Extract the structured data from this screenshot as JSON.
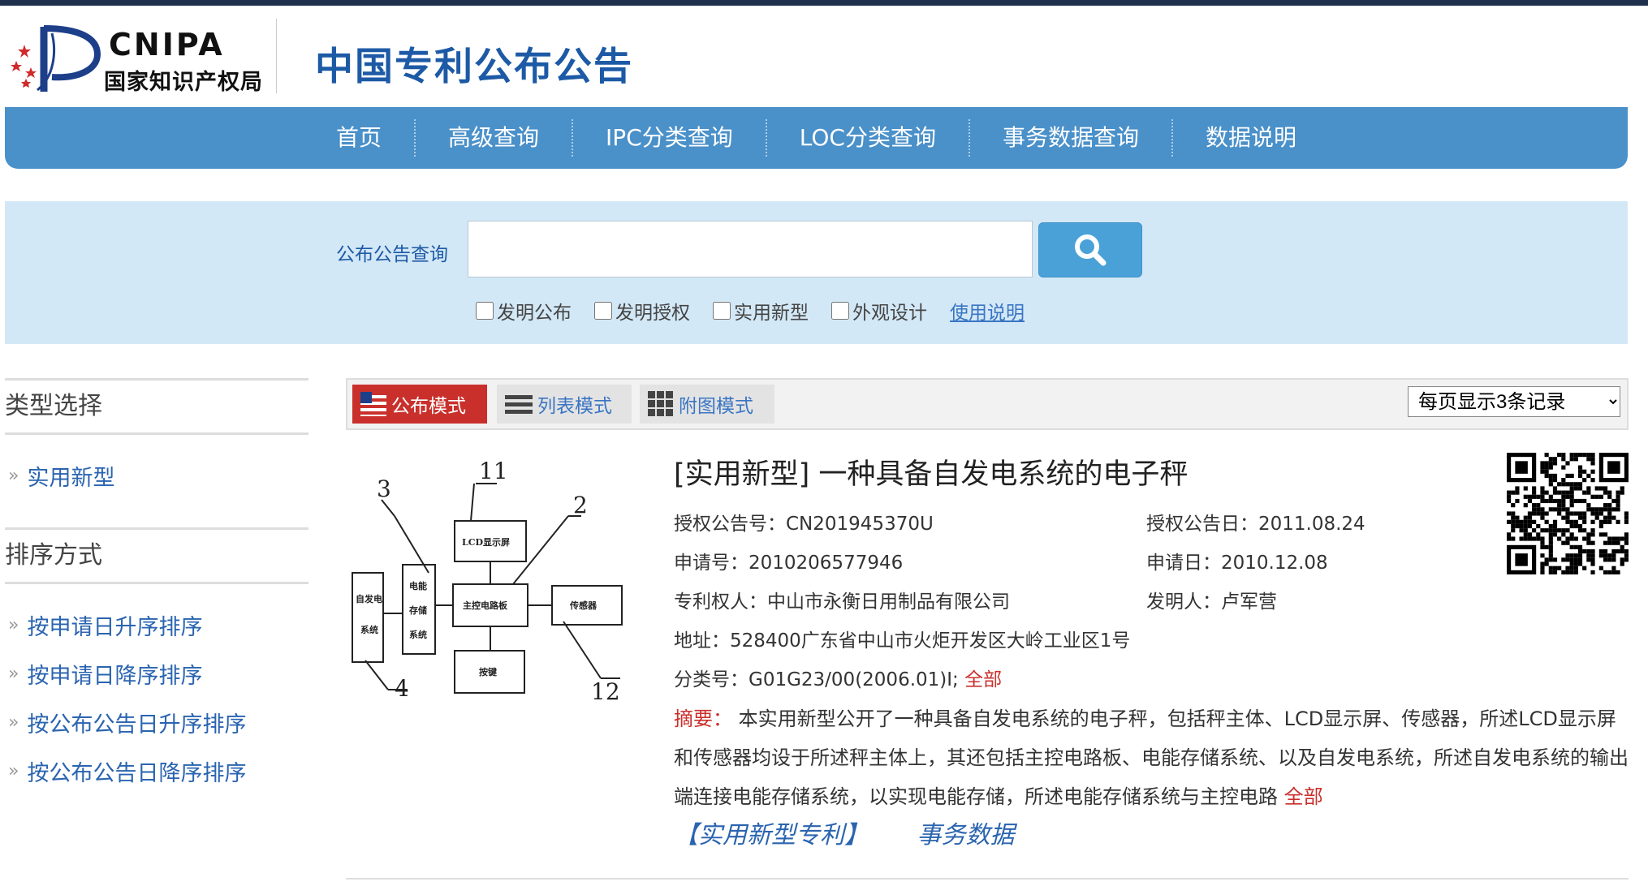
{
  "header": {
    "logo_en": "CNIPA",
    "logo_cn": "国家知识产权局",
    "site_title": "中国专利公布公告"
  },
  "nav": {
    "items": [
      "首页",
      "高级查询",
      "IPC分类查询",
      "LOC分类查询",
      "事务数据查询",
      "数据说明"
    ]
  },
  "search": {
    "label": "公布公告查询",
    "input_value": "",
    "checkboxes": [
      "发明公布",
      "发明授权",
      "实用新型",
      "外观设计"
    ],
    "help_link": "使用说明"
  },
  "sidebar": {
    "type_heading": "类型选择",
    "type_items": [
      "实用新型"
    ],
    "sort_heading": "排序方式",
    "sort_items": [
      "按申请日升序排序",
      "按申请日降序排序",
      "按公布公告日升序排序",
      "按公布公告日降序排序"
    ]
  },
  "toolbar": {
    "modes": [
      "公布模式",
      "列表模式",
      "附图模式"
    ],
    "per_page": "每页显示3条记录",
    "active_color": "#c9302c"
  },
  "record": {
    "title": "[实用新型] 一种具备自发电系统的电子秤",
    "grant_no": "授权公告号：CN201945370U",
    "grant_date": "授权公告日：2011.08.24",
    "app_no": "申请号：2010206577946",
    "app_date": "申请日：2010.12.08",
    "patentee": "专利权人：中山市永衡日用制品有限公司",
    "inventor": "发明人：卢军营",
    "address": "地址：528400广东省中山市火炬开发区大岭工业区1号",
    "ipc": "分类号：G01G23/00(2006.01)I;",
    "ipc_more": "全部",
    "abstract_label": "摘要：",
    "abstract_text": "本实用新型公开了一种具备自发电系统的电子秤，包括秤主体、LCD显示屏、传感器，所述LCD显示屏和传感器均设于所述秤主体上，其还包括主控电路板、电能存储系统、以及自发电系统，所述自发电系统的输出端连接电能存储系统，以实现电能存储，所述电能存储系统与主控电路",
    "abstract_more": "全部",
    "link_patent": "【实用新型专利】",
    "link_affairs": "事务数据",
    "diagram": {
      "label_11": "11",
      "label_3": "3",
      "label_2": "2",
      "label_4": "4",
      "label_12": "12",
      "box_lcd": "LCD显示屏",
      "box_self_1": "自发电",
      "box_self_2": "系统",
      "box_store_1": "电能",
      "box_store_2": "存储",
      "box_store_3": "系统",
      "box_main": "主控电路板",
      "box_sensor": "传感器",
      "box_key": "按键"
    }
  }
}
